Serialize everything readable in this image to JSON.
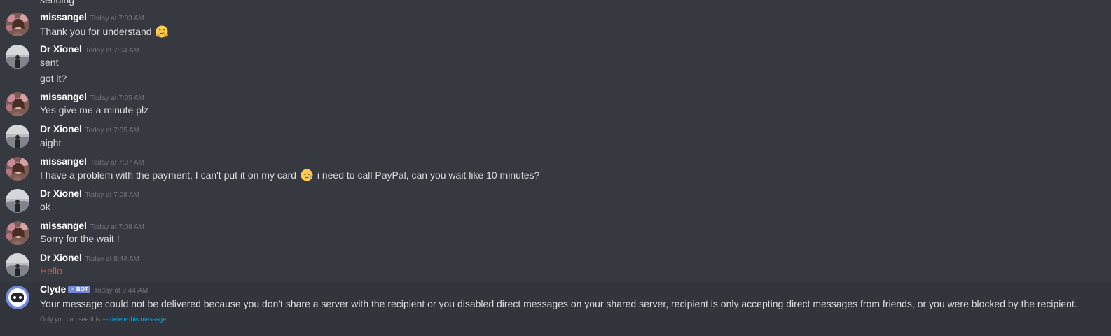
{
  "partial_text": "sending",
  "messages": [
    {
      "author": "missangel",
      "timestamp": "Today at 7:03 AM",
      "lines": [
        "Thank you for understand"
      ],
      "emoji": "hugging-face-emoji"
    },
    {
      "author": "Dr Xionel",
      "timestamp": "Today at 7:04 AM",
      "lines": [
        "sent",
        "got it?"
      ]
    },
    {
      "author": "missangel",
      "timestamp": "Today at 7:05 AM",
      "lines": [
        "Yes give me a minute plz"
      ]
    },
    {
      "author": "Dr Xionel",
      "timestamp": "Today at 7:05 AM",
      "lines": [
        "aight"
      ]
    },
    {
      "author": "missangel",
      "timestamp": "Today at 7:07 AM",
      "line_before_emoji": "I have a problem with the payment, I can't put it on my card",
      "line_after_emoji": "i need to call PayPal, can you wait like 10 minutes?",
      "emoji": "sleepy-face-emoji"
    },
    {
      "author": "Dr Xionel",
      "timestamp": "Today at 7:08 AM",
      "lines": [
        "ok"
      ]
    },
    {
      "author": "missangel",
      "timestamp": "Today at 7:08 AM",
      "lines": [
        "Sorry for the wait !"
      ]
    },
    {
      "author": "Dr Xionel",
      "timestamp": "Today at 8:44 AM",
      "lines": [
        "Hello"
      ],
      "text_color": "#f04747"
    }
  ],
  "clyde": {
    "author": "Clyde",
    "bot_tag": "✓ BOT",
    "timestamp": "Today at 8:44 AM",
    "text": "Your message could not be delivered because you don't share a server with the recipient or you disabled direct messages on your shared server, recipient is only accepting direct messages from friends, or you were blocked by the recipient.",
    "ephemeral_note": "Only you can see this —",
    "delete_link": "delete this message."
  },
  "colors": {
    "background": "#36393f",
    "text": "#dcddde",
    "username": "#ffffff",
    "timestamp": "#72767d",
    "error_text": "#f04747",
    "bot_tag": "#7289da",
    "link": "#00b0f4"
  }
}
